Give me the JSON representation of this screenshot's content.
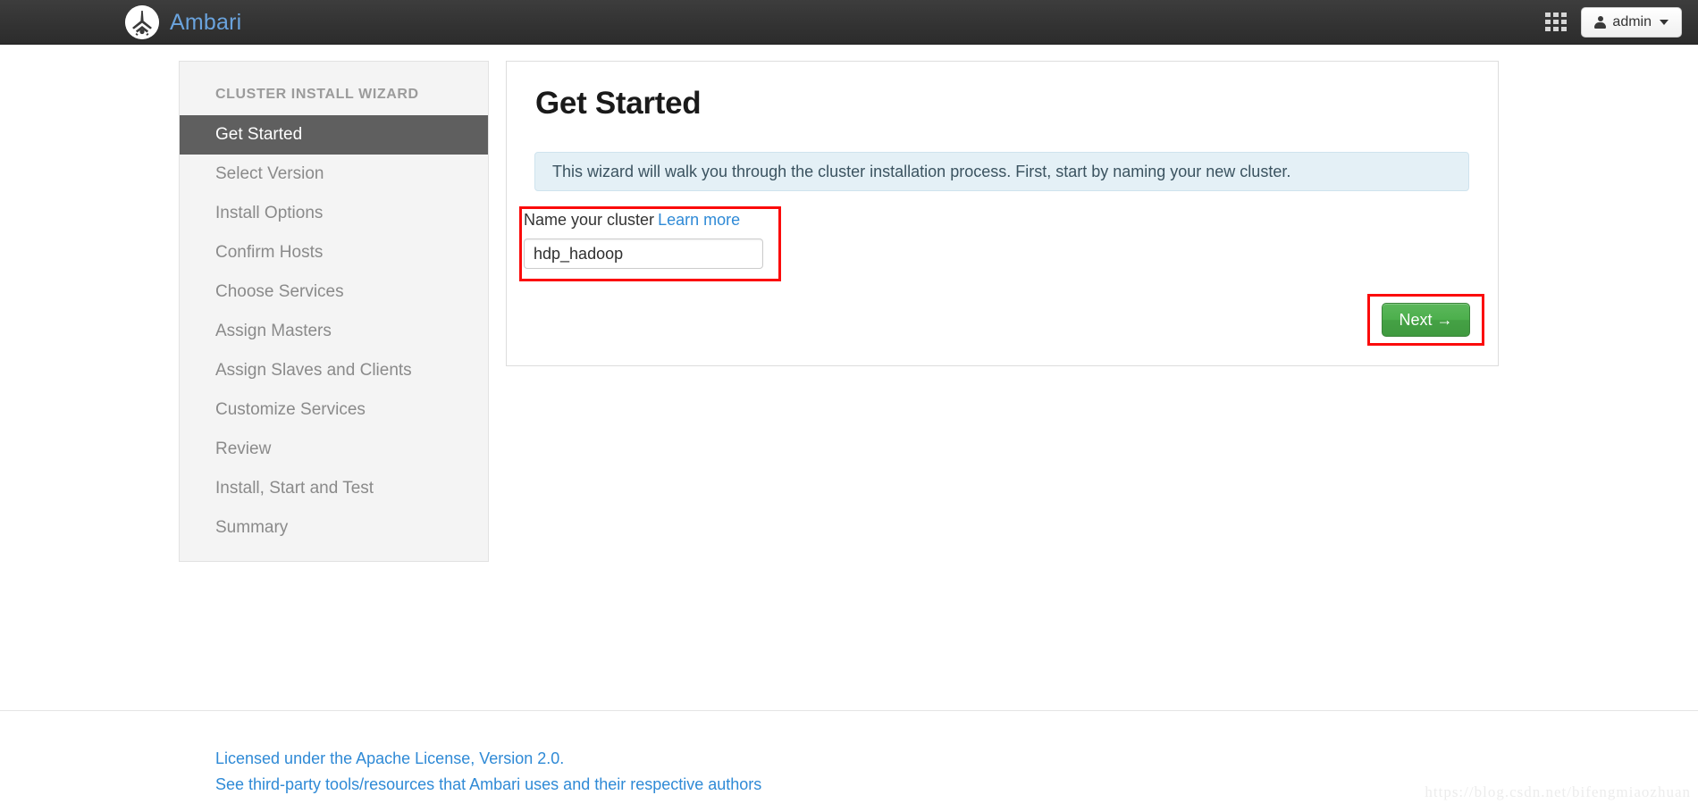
{
  "topnav": {
    "logo_icon": "ambari-logo-icon",
    "brand_title": "Ambari",
    "grid_icon": "apps-grid-icon",
    "user_icon": "user-icon",
    "admin_label": "admin",
    "caret_icon": "chevron-down-icon",
    "background_color": "#333333",
    "brand_color": "#6aa3dd"
  },
  "sidebar": {
    "heading": "CLUSTER INSTALL WIZARD",
    "active_index": 0,
    "active_background": "#5f5f5f",
    "items": [
      {
        "label": "Get Started"
      },
      {
        "label": "Select Version"
      },
      {
        "label": "Install Options"
      },
      {
        "label": "Confirm Hosts"
      },
      {
        "label": "Choose Services"
      },
      {
        "label": "Assign Masters"
      },
      {
        "label": "Assign Slaves and Clients"
      },
      {
        "label": "Customize Services"
      },
      {
        "label": "Review"
      },
      {
        "label": "Install, Start and Test"
      },
      {
        "label": "Summary"
      }
    ]
  },
  "main": {
    "title": "Get Started",
    "alert_text": "This wizard will walk you through the cluster installation process. First, start by naming your new cluster.",
    "alert_background": "#e4f0f6",
    "cluster_name": {
      "label": "Name your cluster",
      "learn_more_label": "Learn more",
      "value": "hdp_hadoop",
      "placeholder": "",
      "highlight_color": "#fb0b0b"
    },
    "next_button": {
      "label": "Next →",
      "color": "#4caf4c",
      "highlight_color": "#fb0b0b"
    }
  },
  "footer": {
    "links": [
      {
        "label": "Licensed under the Apache License, Version 2.0."
      },
      {
        "label": "See third-party tools/resources that Ambari uses and their respective authors"
      }
    ],
    "link_color": "#2f8ad6"
  },
  "watermark": {
    "text": "https://blog.csdn.net/bifengmiaozhuan"
  }
}
